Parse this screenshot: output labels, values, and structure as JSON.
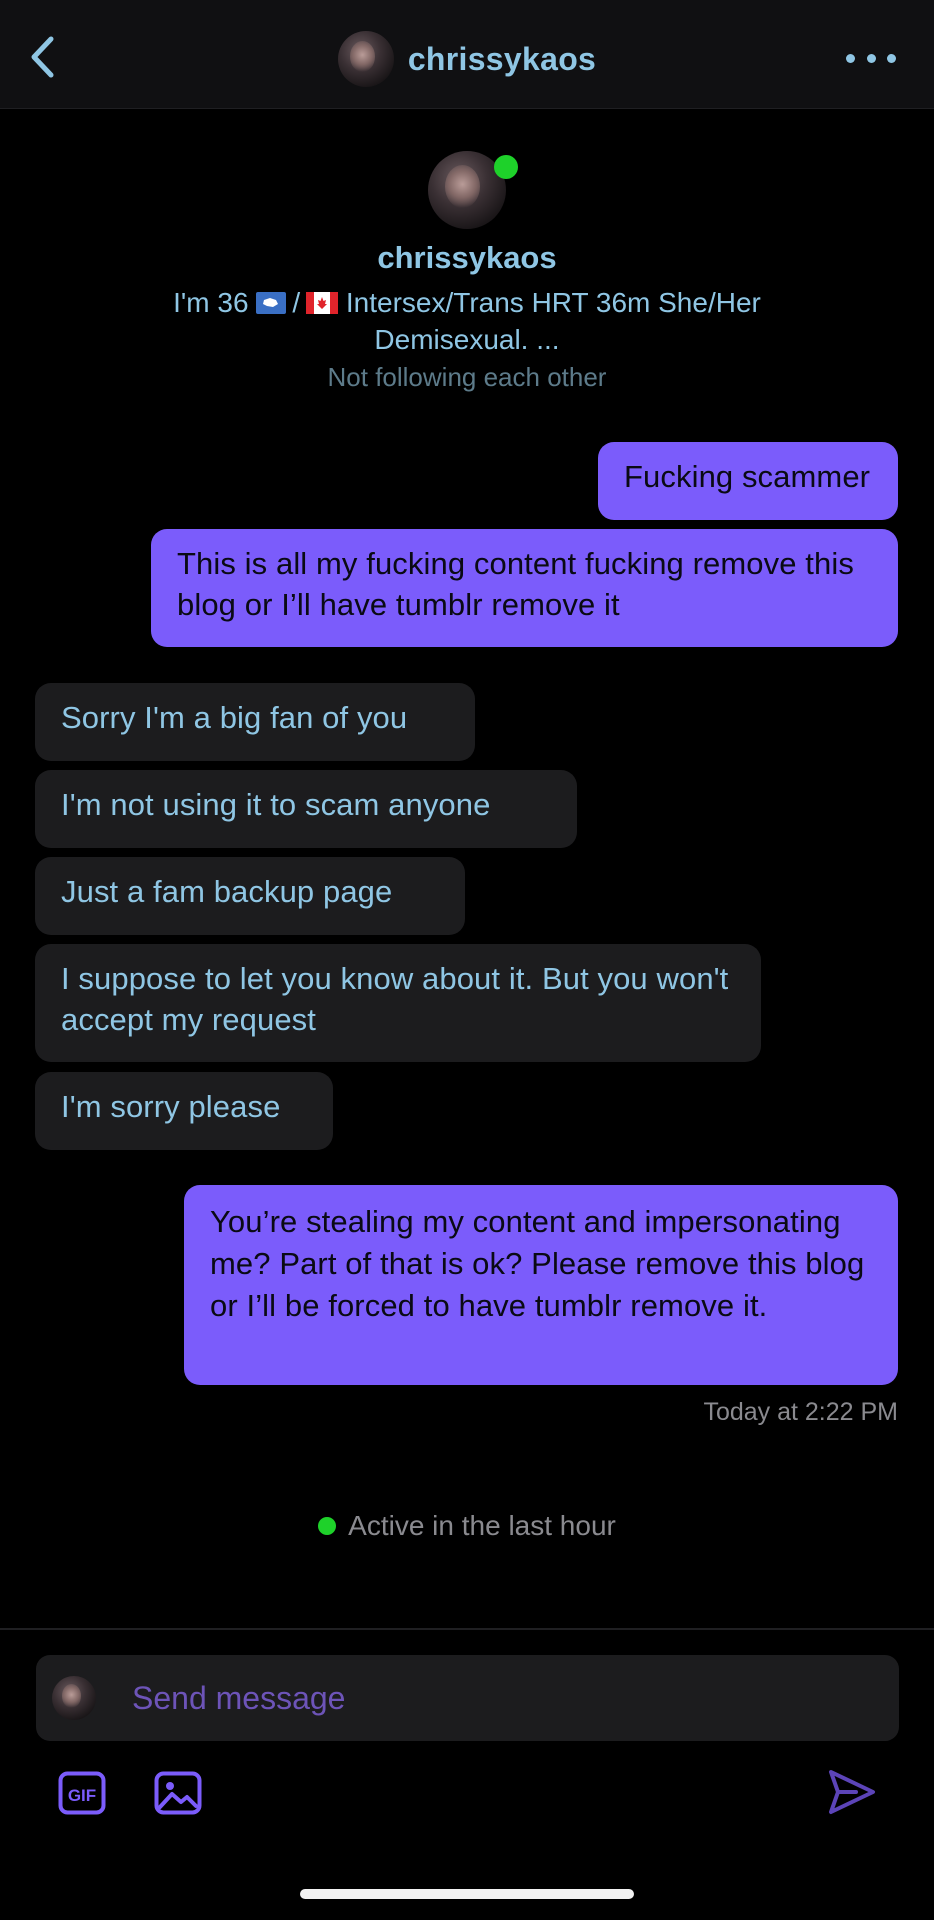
{
  "header": {
    "username": "chrissykaos",
    "icons": {
      "back": "chevron-left-icon",
      "more": "more-horizontal-icon"
    }
  },
  "profile": {
    "username": "chrissykaos",
    "bio_part1": "I'm 36 ",
    "bio_part2": " Intersex/Trans HRT 36m She/Her Demisexual. ...",
    "bio_flag_separator": "/",
    "follow_status": "Not following each other",
    "online": true
  },
  "messages": [
    {
      "sender": "me",
      "text": "Fucking scammer"
    },
    {
      "sender": "me",
      "text": "This is all my fucking content fucking remove this blog or I’ll have tumblr remove it"
    },
    {
      "sender": "them",
      "text": "Sorry I'm a big fan of you"
    },
    {
      "sender": "them",
      "text": "I'm not using it to scam anyone"
    },
    {
      "sender": "them",
      "text": "Just a fam backup page"
    },
    {
      "sender": "them",
      "text": "I suppose to let you know about it. But you won't accept my request"
    },
    {
      "sender": "them",
      "text": "I'm sorry please"
    },
    {
      "sender": "me",
      "text": "You’re stealing my content and impersonating me? Part of that is ok? Please remove this blog or I’ll be forced to have tumblr remove it."
    }
  ],
  "timestamp": "Today at 2:22 PM",
  "active_status": "Active in the last hour",
  "composer": {
    "placeholder": "Send message",
    "value": "",
    "gif_label": "GIF"
  },
  "colors": {
    "accent": "#7b5cfb",
    "text_blue": "#8fc6e4",
    "online_green": "#1ed12a",
    "incoming_bubble": "#1c1c1e",
    "background": "#000000"
  }
}
